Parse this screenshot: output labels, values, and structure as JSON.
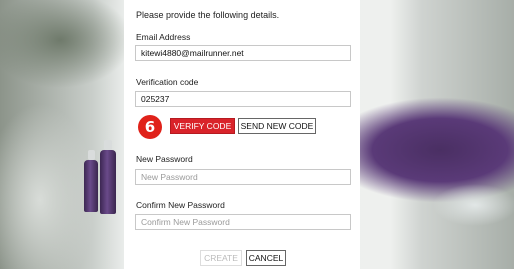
{
  "form": {
    "intro_text": "Please provide the following details.",
    "email": {
      "label": "Email Address",
      "value": "kitewi4880@mailrunner.net"
    },
    "verification": {
      "label": "Verification code",
      "value": "025237"
    },
    "step_badge": "6",
    "verify_button": "VERIFY CODE",
    "send_new_button": "SEND NEW CODE",
    "new_password": {
      "label": "New Password",
      "placeholder": "New Password"
    },
    "confirm_password": {
      "label": "Confirm New Password",
      "placeholder": "Confirm New Password"
    },
    "create_button": "CREATE",
    "cancel_button": "CANCEL"
  },
  "colors": {
    "accent_red": "#d9232a",
    "badge_red": "#e0221a",
    "disabled_text": "#bbbbbb"
  }
}
